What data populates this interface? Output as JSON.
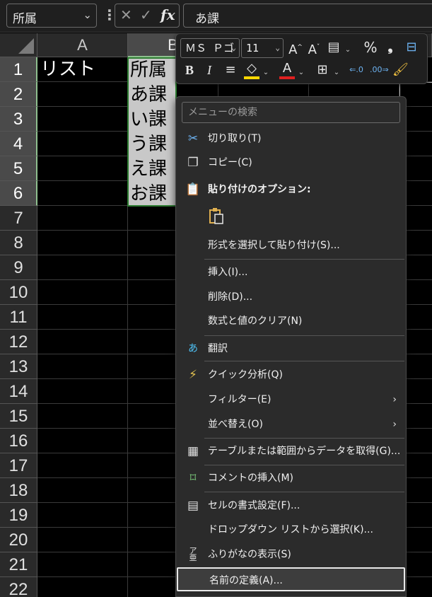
{
  "formula_bar": {
    "name_box": "所属",
    "dots": "⋮",
    "cancel": "✕",
    "enter": "✓",
    "fx": "fx",
    "value": "あ課"
  },
  "columns": [
    "A",
    "B"
  ],
  "rows": [
    "1",
    "2",
    "3",
    "4",
    "5",
    "6",
    "7",
    "8",
    "9",
    "10",
    "11",
    "12",
    "13",
    "14",
    "15",
    "16",
    "17",
    "18",
    "19",
    "20",
    "21",
    "22"
  ],
  "cells": {
    "A1": "リスト",
    "B1": "所属",
    "B2": "あ課",
    "B3": "い課",
    "B4": "う課",
    "B5": "え課",
    "B6": "お課"
  },
  "mini_toolbar": {
    "font_name": "ＭＳ Ｐゴ",
    "font_size": "11",
    "bold": "B",
    "italic": "I"
  },
  "menu": {
    "search_placeholder": "メニューの検索",
    "items": {
      "cut": "切り取り(T)",
      "copy": "コピー(C)",
      "paste_options": "貼り付けのオプション:",
      "paste_special": "形式を選択して貼り付け(S)...",
      "insert": "挿入(I)...",
      "delete": "削除(D)...",
      "clear": "数式と値のクリア(N)",
      "translate": "翻訳",
      "quick_analysis": "クイック分析(Q)",
      "filter": "フィルター(E)",
      "sort": "並べ替え(O)",
      "get_data": "テーブルまたは範囲からデータを取得(G)...",
      "insert_comment": "コメントの挿入(M)",
      "format_cells": "セルの書式設定(F)...",
      "dropdown_pick": "ドロップダウン リストから選択(K)...",
      "phonetic": "ふりがなの表示(S)",
      "define_name": "名前の定義(A)..."
    }
  },
  "colors": {
    "accent_green": "#2e7d32",
    "highlight_yellow": "#ffd700",
    "font_red": "#e02020"
  }
}
